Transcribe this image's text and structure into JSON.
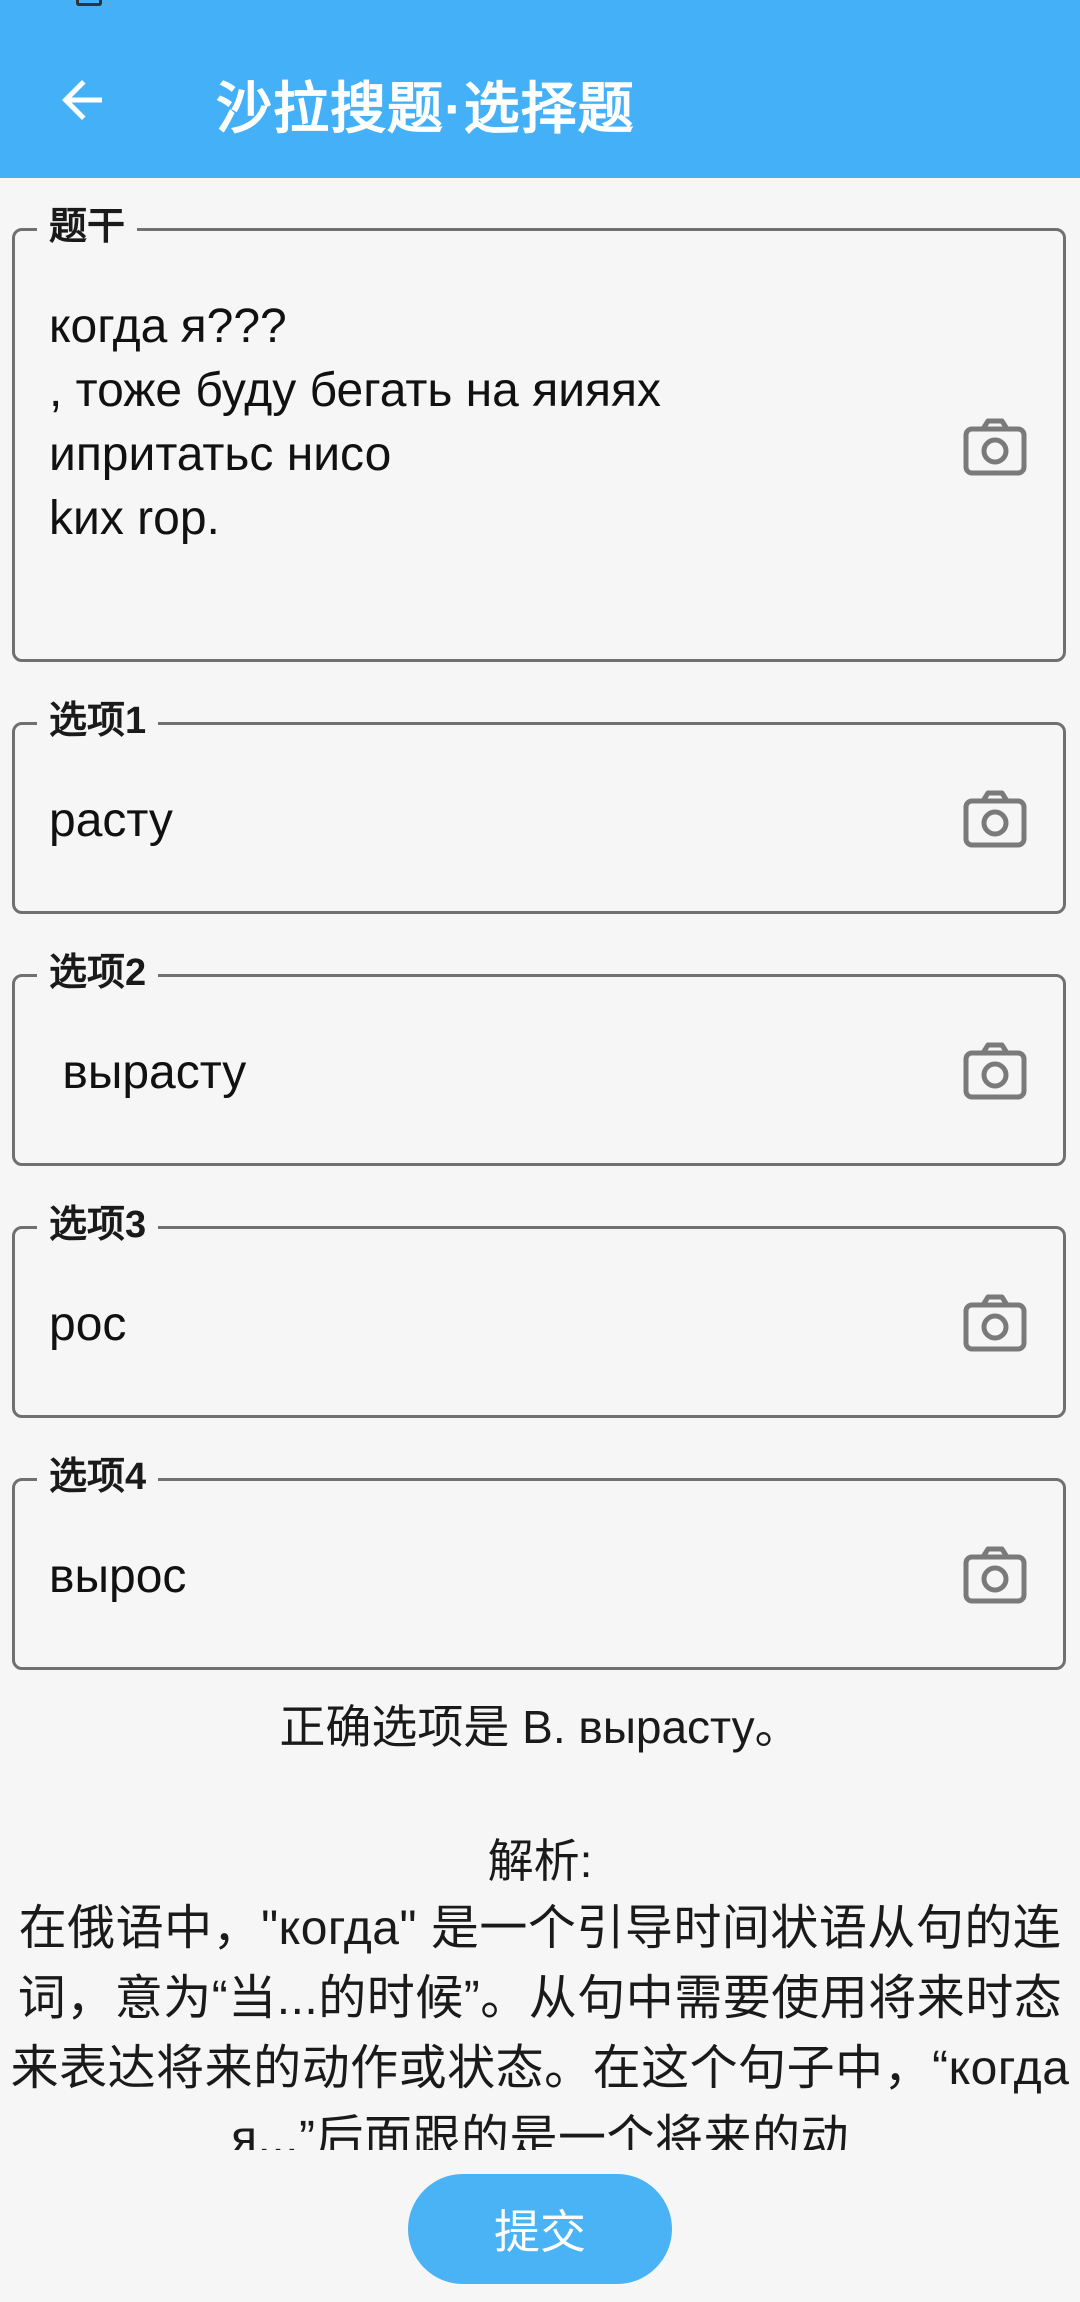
{
  "app_bar": {
    "title": "沙拉搜题·选择题"
  },
  "question": {
    "label": "题干",
    "text": "когда я???\n, тоже буду бегать на яияях\nипритатьс нисо\nkих rop."
  },
  "options": [
    {
      "label": "选项1",
      "value": "расту"
    },
    {
      "label": "选项2",
      "value": " вырасту"
    },
    {
      "label": "选项3",
      "value": "рос"
    },
    {
      "label": "选项4",
      "value": "вырос"
    }
  ],
  "answer": {
    "correct": "正确选项是 B. вырасту。",
    "analysis_title": "解析:",
    "analysis_body": "在俄语中，\"когда\" 是一个引导时间状语从句的连词，意为“当...的时候”。从句中需要使用将来时态来表达将来的动作或状态。在这个句子中，“когда я...”后面跟的是一个将来的动"
  },
  "submit": {
    "label": "提交"
  },
  "icons": {
    "back": "arrow-left-icon",
    "camera": "camera-icon"
  },
  "colors": {
    "accent": "#44b0f8",
    "submit": "#4ab3f6",
    "border": "#707070",
    "background": "#f6f6f6"
  }
}
